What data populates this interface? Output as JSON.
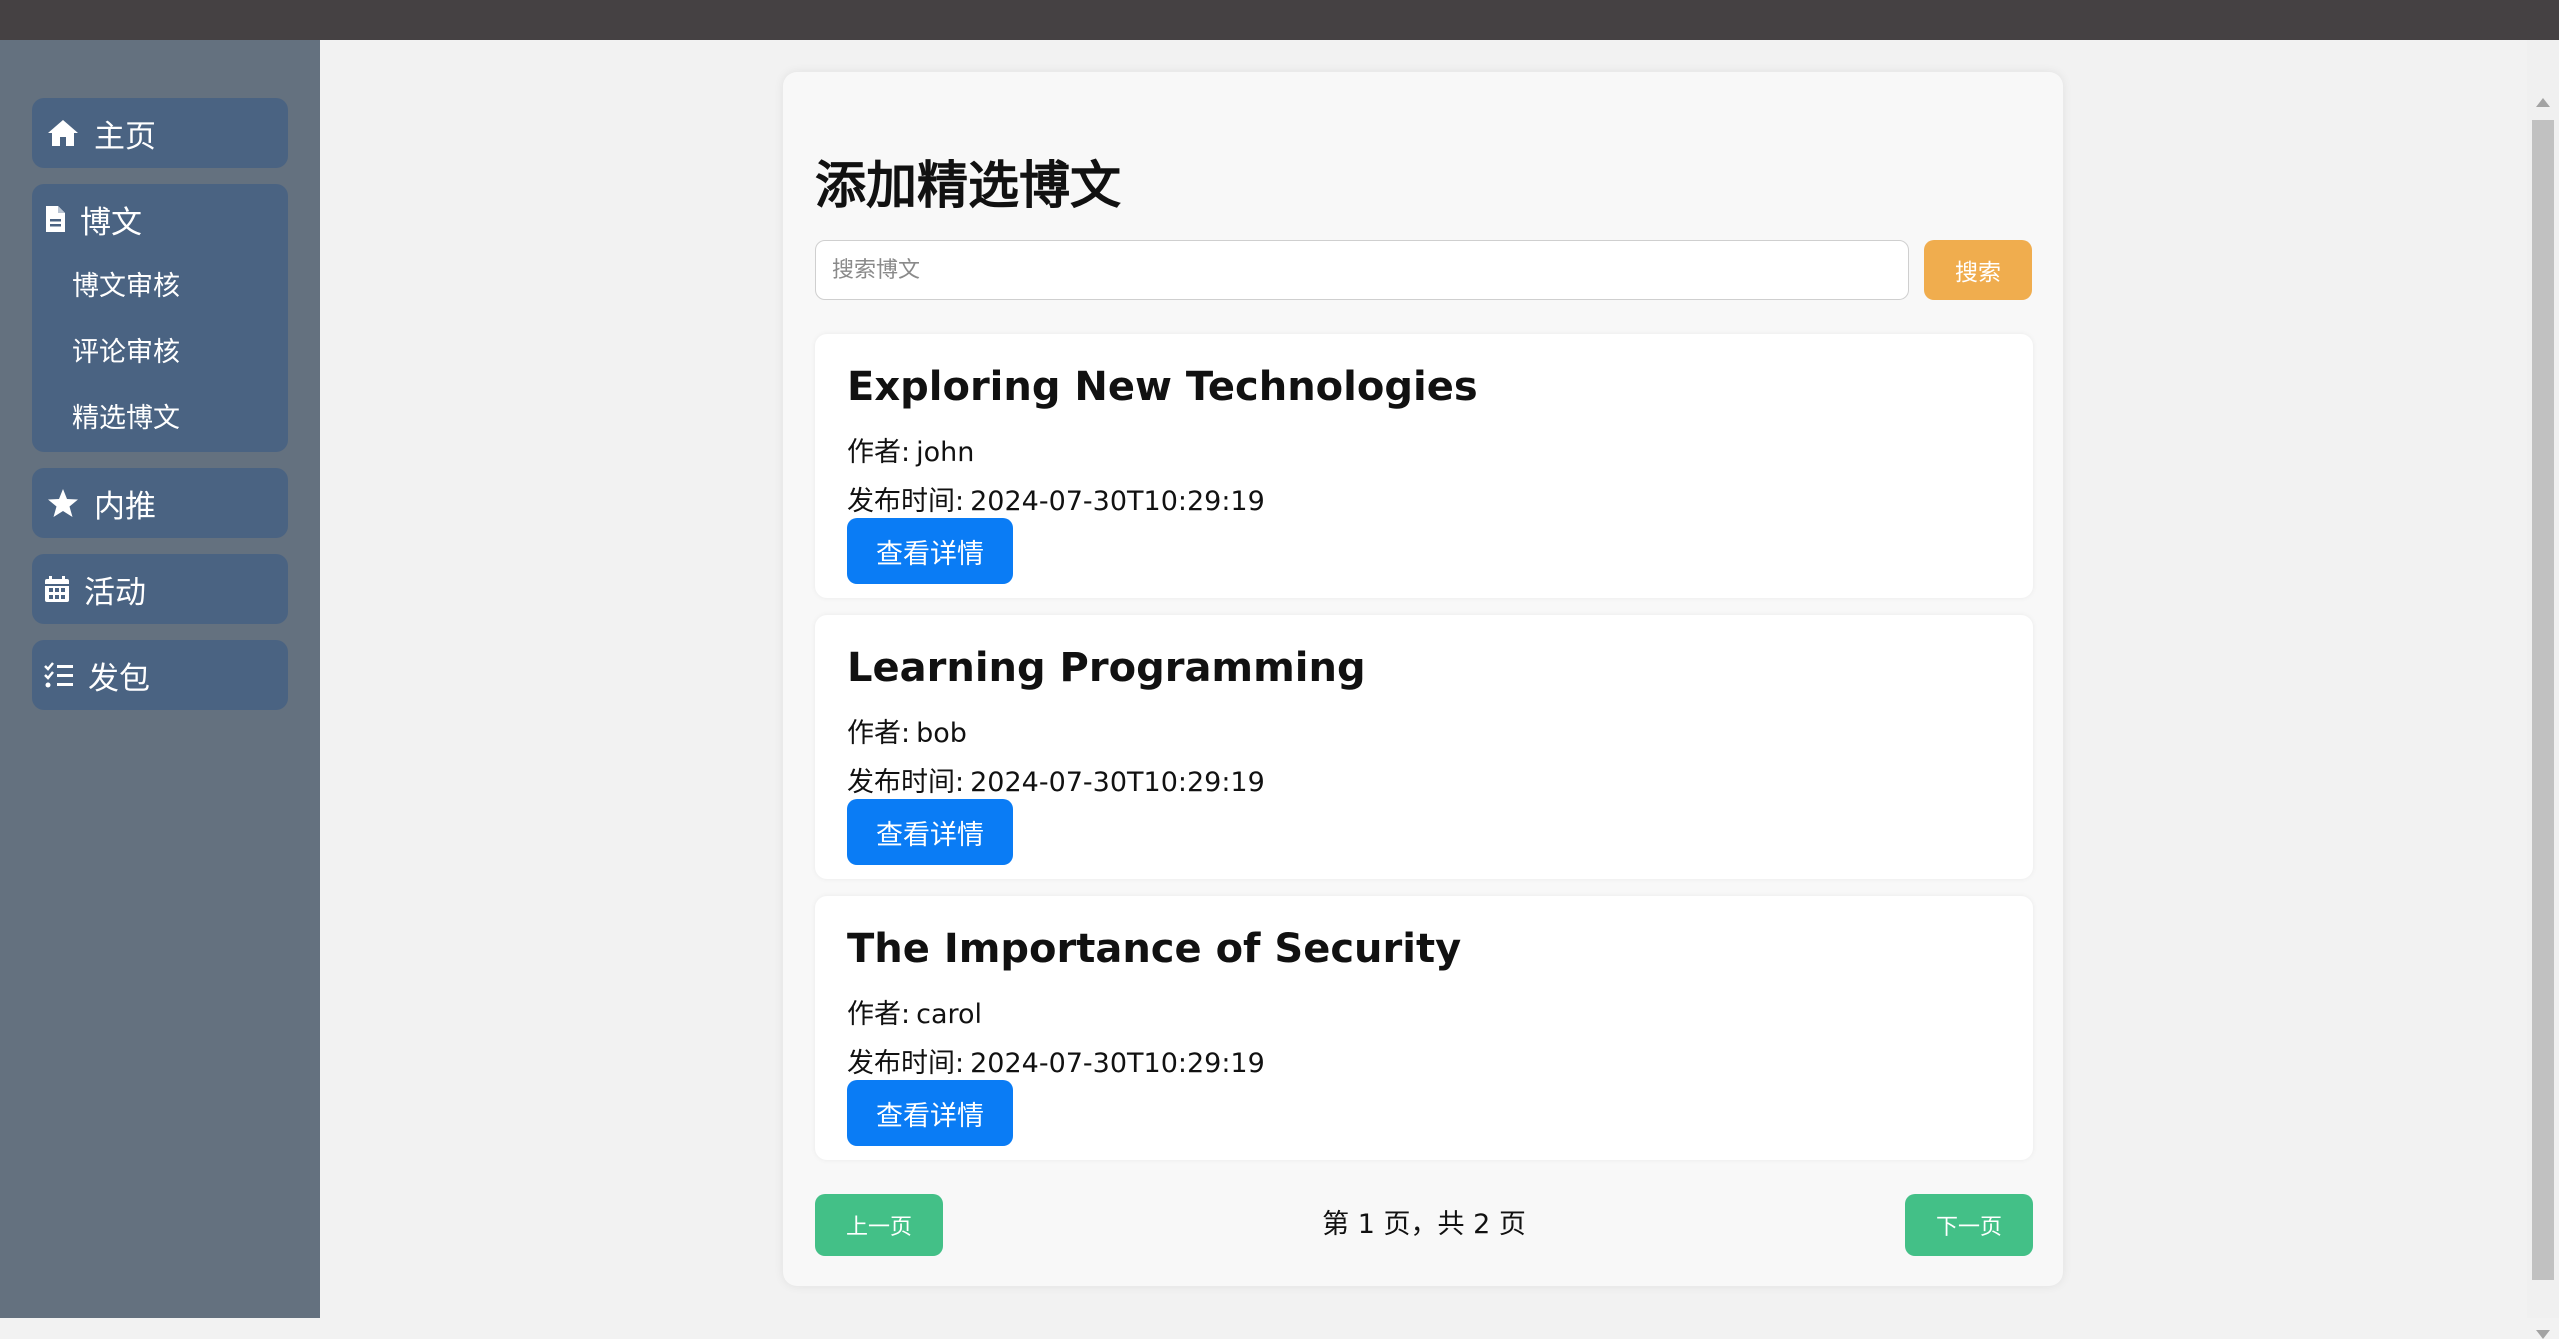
{
  "sidebar": {
    "items": [
      {
        "label": "主页",
        "icon": "home-icon"
      },
      {
        "label": "博文",
        "icon": "file-icon",
        "children": [
          {
            "label": "博文审核"
          },
          {
            "label": "评论审核"
          },
          {
            "label": "精选博文"
          }
        ]
      },
      {
        "label": "内推",
        "icon": "star-icon"
      },
      {
        "label": "活动",
        "icon": "calendar-icon"
      },
      {
        "label": "发包",
        "icon": "checklist-icon"
      }
    ]
  },
  "main": {
    "title": "添加精选博文",
    "search": {
      "placeholder": "搜索博文",
      "button_label": "搜索"
    },
    "author_label": "作者:",
    "time_label": "发布时间:",
    "detail_label": "查看详情",
    "posts": [
      {
        "title": "Exploring New Technologies",
        "author": "john",
        "published": "2024-07-30T10:29:19"
      },
      {
        "title": "Learning Programming",
        "author": "bob",
        "published": "2024-07-30T10:29:19"
      },
      {
        "title": "The Importance of Security",
        "author": "carol",
        "published": "2024-07-30T10:29:19"
      }
    ],
    "pagination": {
      "prev_label": "上一页",
      "next_label": "下一页",
      "status": "第 1 页，共 2 页"
    }
  },
  "colors": {
    "topbar": "#454143",
    "sidebar_bg": "#64717f",
    "nav_item_bg": "#4a6382",
    "search_button": "#f0ad4e",
    "detail_button": "#0a7cf5",
    "pager_button": "#43c087"
  }
}
